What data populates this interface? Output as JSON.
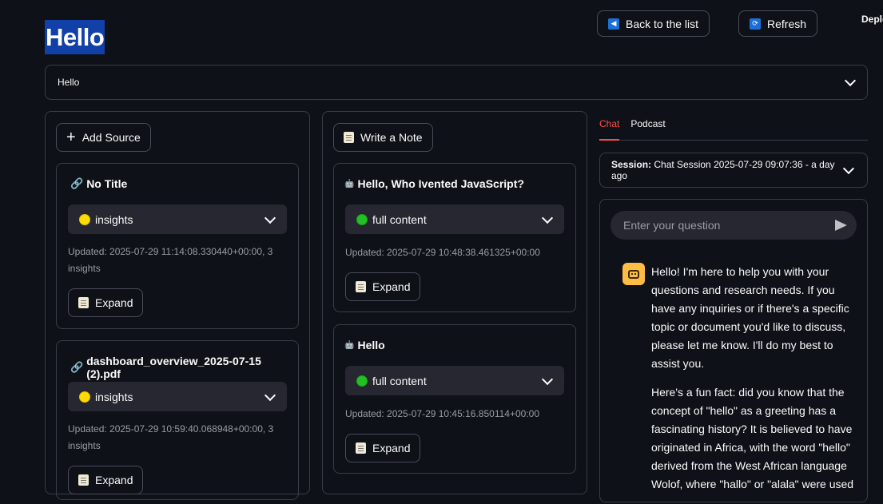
{
  "page_title": "Hello",
  "header": {
    "back_label": "Back to the list",
    "back_icon": "back-icon",
    "refresh_label": "Refresh",
    "refresh_icon": "refresh-icon",
    "deploy_label": "Deplo"
  },
  "notebook_select": {
    "value": "Hello"
  },
  "sources": {
    "add_label": "Add Source",
    "items": [
      {
        "title": "No Title",
        "status": "insights",
        "status_color": "#ffdc00",
        "meta": "Updated: 2025-07-29 11:14:08.330440+00:00, 3 insights",
        "expand_label": "Expand"
      },
      {
        "title": "dashboard_overview_2025-07-15 (2).pdf",
        "status": "insights",
        "status_color": "#ffdc00",
        "meta": "Updated: 2025-07-29 10:59:40.068948+00:00, 3 insights",
        "expand_label": "Expand"
      }
    ]
  },
  "notes": {
    "write_label": "Write a Note",
    "items": [
      {
        "title": "Hello, Who Ivented JavaScript?",
        "status": "full content",
        "status_color": "#21c124",
        "meta": "Updated: 2025-07-29 10:48:38.461325+00:00",
        "expand_label": "Expand"
      },
      {
        "title": "Hello",
        "status": "full content",
        "status_color": "#21c124",
        "meta": "Updated: 2025-07-29 10:45:16.850114+00:00",
        "expand_label": "Expand"
      }
    ]
  },
  "chat": {
    "tabs": [
      "Chat",
      "Podcast"
    ],
    "session_label": "Session:",
    "session_value": "Chat Session 2025-07-29 09:07:36 - a day ago",
    "input_placeholder": "Enter your question",
    "messages": [
      "Hello! I'm here to help you with your questions and research needs. If you have any inquiries or if there's a specific topic or document you'd like to discuss, please let me know. I'll do my best to assist you.",
      "Here's a fun fact: did you know that the concept of \"hello\" as a greeting has a fascinating history? It is believed to have originated in Africa, with the word \"hello\" derived from the West African language Wolof, where \"hallo\" or \"alala\" were used"
    ]
  }
}
